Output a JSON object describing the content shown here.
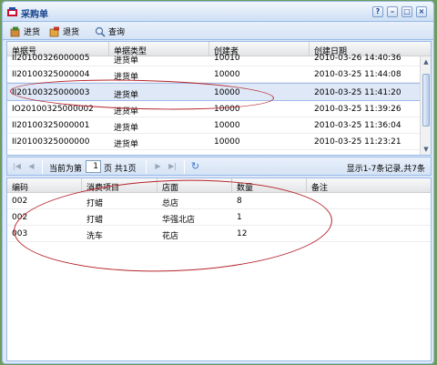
{
  "window": {
    "title": "采购单"
  },
  "toolbar": {
    "items": [
      {
        "label": "进货",
        "icon": "stock-in-icon"
      },
      {
        "label": "退货",
        "icon": "return-icon"
      },
      {
        "label": "查询",
        "icon": "search-icon"
      }
    ]
  },
  "grid1": {
    "columns": [
      "单据号",
      "单据类型",
      "创建者",
      "创建日期"
    ],
    "rows": [
      {
        "id": "II20100326000005",
        "type": "进货单",
        "creator": "10010",
        "date": "2010-03-26 14:40:36"
      },
      {
        "id": "II20100325000004",
        "type": "进货单",
        "creator": "10000",
        "date": "2010-03-25 11:44:08"
      },
      {
        "id": "II20100325000003",
        "type": "进货单",
        "creator": "10000",
        "date": "2010-03-25 11:41:20"
      },
      {
        "id": "IO20100325000002",
        "type": "进货单",
        "creator": "10000",
        "date": "2010-03-25 11:39:26"
      },
      {
        "id": "II20100325000001",
        "type": "进货单",
        "creator": "10000",
        "date": "2010-03-25 11:36:04"
      },
      {
        "id": "II20100325000000",
        "type": "进货单",
        "creator": "10000",
        "date": "2010-03-25 11:23:21"
      }
    ]
  },
  "pager": {
    "current_label": "当前为第",
    "page_value": "1",
    "total_label": "页 共1页",
    "status": "显示1-7条记录,共7条"
  },
  "grid2": {
    "columns": [
      "编码",
      "消费项目",
      "店面",
      "数量",
      "备注"
    ],
    "rows": [
      {
        "code": "002",
        "item": "打蜡",
        "store": "总店",
        "qty": "8",
        "note": ""
      },
      {
        "code": "002",
        "item": "打蜡",
        "store": "华强北店",
        "qty": "1",
        "note": ""
      },
      {
        "code": "003",
        "item": "洗车",
        "store": "花店",
        "qty": "12",
        "note": ""
      }
    ]
  }
}
